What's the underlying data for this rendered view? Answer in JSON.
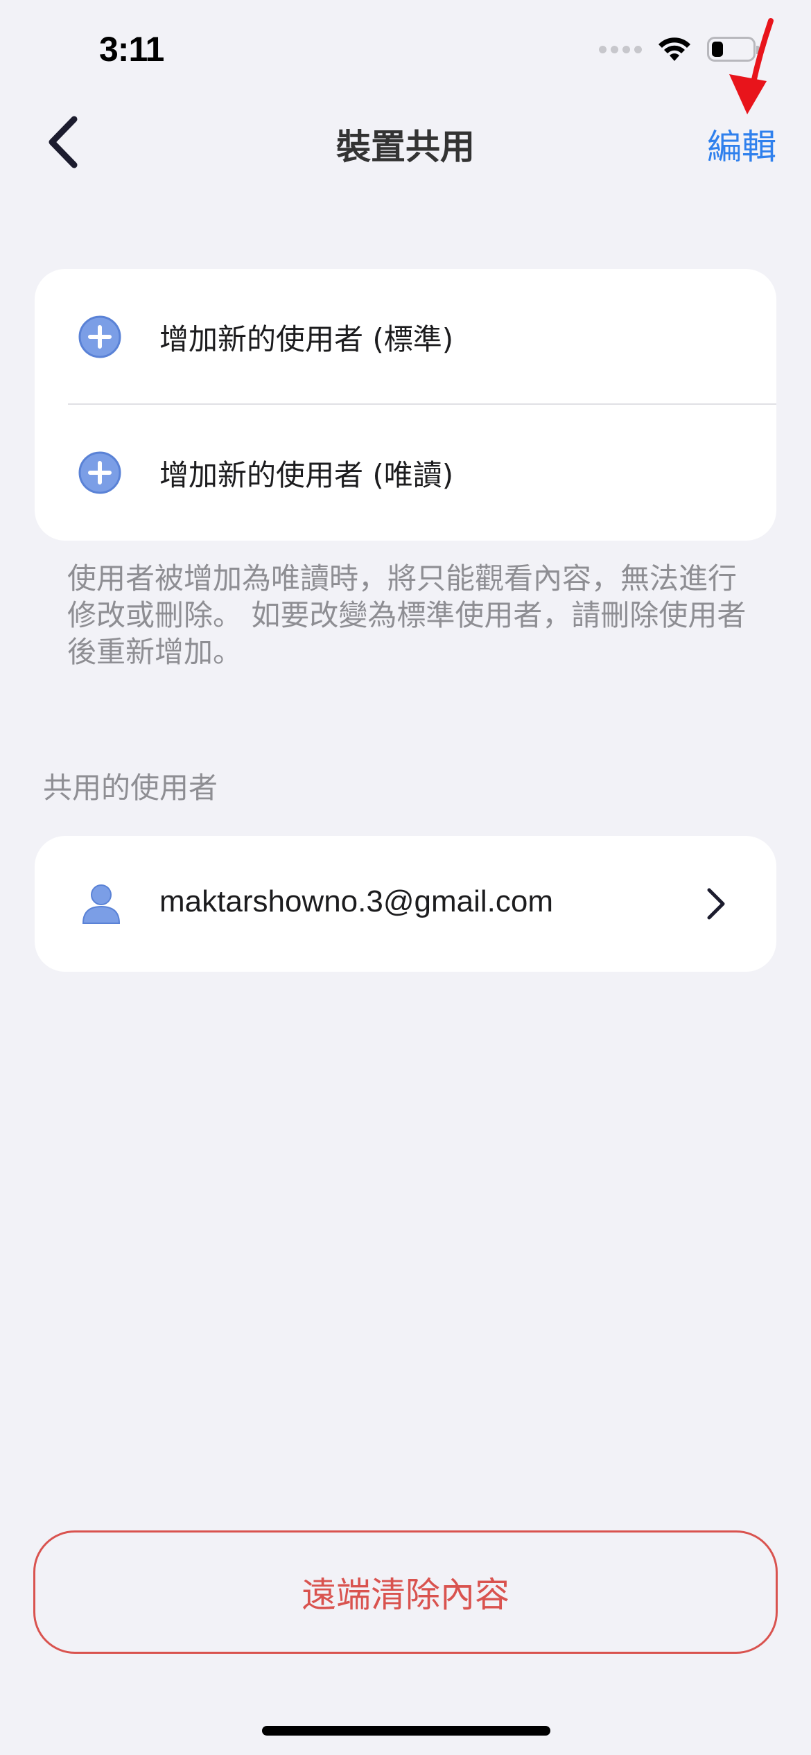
{
  "status_bar": {
    "time": "3:11"
  },
  "nav": {
    "title": "裝置共用",
    "edit_label": "編輯"
  },
  "add_users": {
    "items": [
      {
        "label": "增加新的使用者 (標準)",
        "icon": "plus-circle-icon"
      },
      {
        "label": "增加新的使用者 (唯讀)",
        "icon": "plus-circle-icon"
      }
    ],
    "helper_text": "使用者被增加為唯讀時，將只能觀看內容，無法進行修改或刪除。 如要改變為標準使用者，請刪除使用者後重新增加。"
  },
  "shared_users": {
    "section_label": "共用的使用者",
    "users": [
      {
        "email": "maktarshowno.3@gmail.com",
        "icon": "person-icon"
      }
    ]
  },
  "actions": {
    "remote_wipe_label": "遠端清除內容"
  },
  "colors": {
    "accent": "#2f80ed",
    "danger": "#d9534f",
    "background": "#f2f2f7",
    "icon_blue": "#7b9ee6",
    "annotation_arrow": "#e8141b"
  }
}
